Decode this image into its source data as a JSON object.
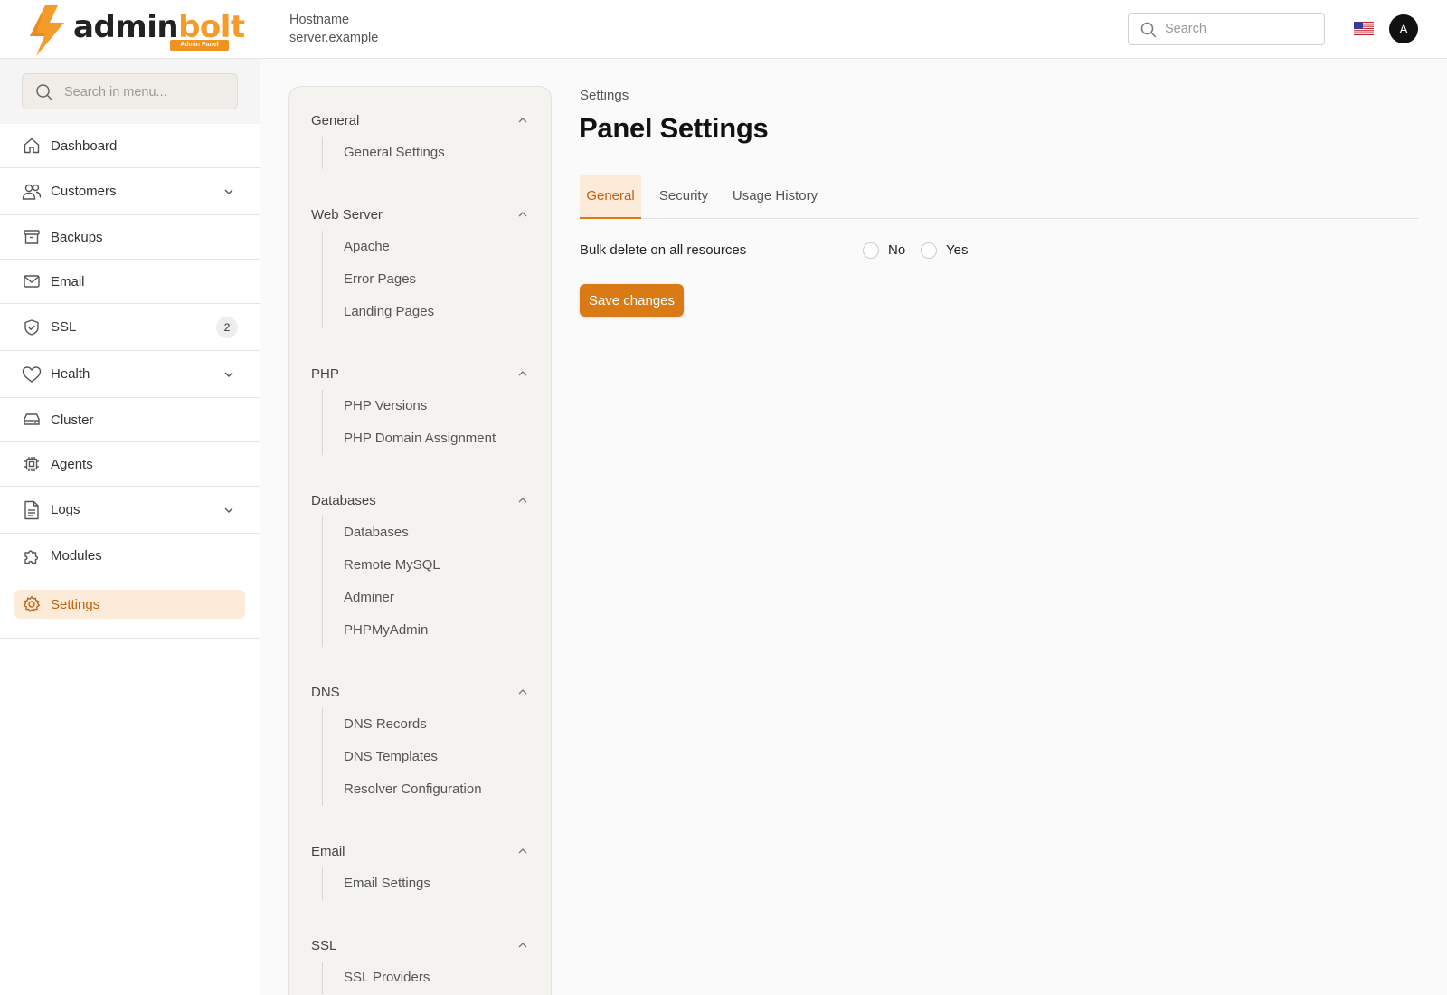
{
  "brand": {
    "name_part1": "admin",
    "name_part2": "bolt",
    "badge": "Admin Panel",
    "accent": "#f59b2a"
  },
  "header": {
    "hostname_label": "Hostname",
    "hostname_value": "server.example",
    "search_placeholder": "Search",
    "flag_icon": "us-flag-icon",
    "avatar_initial": "A"
  },
  "sidebar": {
    "search_placeholder": "Search in menu...",
    "items": [
      {
        "label": "Dashboard",
        "icon": "home-icon"
      },
      {
        "label": "Customers",
        "icon": "users-icon",
        "expandable": true
      },
      {
        "label": "Backups",
        "icon": "archive-icon"
      },
      {
        "label": "Email",
        "icon": "mail-icon"
      },
      {
        "label": "SSL",
        "icon": "shield-check-icon",
        "badge": "2"
      },
      {
        "label": "Health",
        "icon": "heart-icon",
        "expandable": true
      },
      {
        "label": "Cluster",
        "icon": "server-icon"
      },
      {
        "label": "Agents",
        "icon": "chip-icon"
      },
      {
        "label": "Logs",
        "icon": "file-text-icon",
        "expandable": true
      },
      {
        "label": "Modules",
        "icon": "puzzle-icon"
      },
      {
        "label": "Settings",
        "icon": "gear-icon",
        "active": true
      }
    ]
  },
  "settings_nav": {
    "groups": [
      {
        "title": "General",
        "items": [
          "General Settings"
        ]
      },
      {
        "title": "Web Server",
        "items": [
          "Apache",
          "Error Pages",
          "Landing Pages"
        ]
      },
      {
        "title": "PHP",
        "items": [
          "PHP Versions",
          "PHP Domain Assignment"
        ]
      },
      {
        "title": "Databases",
        "items": [
          "Databases",
          "Remote MySQL",
          "Adminer",
          "PHPMyAdmin"
        ]
      },
      {
        "title": "DNS",
        "items": [
          "DNS Records",
          "DNS Templates",
          "Resolver Configuration"
        ]
      },
      {
        "title": "Email",
        "items": [
          "Email Settings"
        ]
      },
      {
        "title": "SSL",
        "items": [
          "SSL Providers"
        ]
      }
    ]
  },
  "main": {
    "breadcrumb": "Settings",
    "title": "Panel Settings",
    "tabs": [
      {
        "label": "General",
        "active": true
      },
      {
        "label": "Security"
      },
      {
        "label": "Usage History"
      }
    ],
    "field": {
      "label": "Bulk delete on all resources",
      "options": [
        "No",
        "Yes"
      ]
    },
    "save_label": "Save changes",
    "primary_color": "#d97a14"
  }
}
